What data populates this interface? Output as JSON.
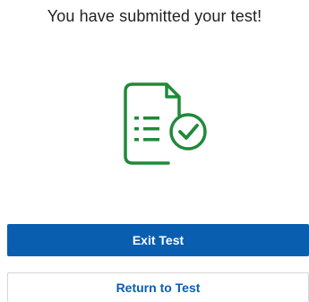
{
  "header": {
    "title": "You have submitted your test!"
  },
  "illustration": {
    "icon": "document-checkmark-icon",
    "color": "#1f8a3a"
  },
  "actions": {
    "primary_label": "Exit Test",
    "secondary_label": "Return to Test"
  },
  "colors": {
    "primary_button": "#0a5eb0",
    "text": "#222222"
  }
}
